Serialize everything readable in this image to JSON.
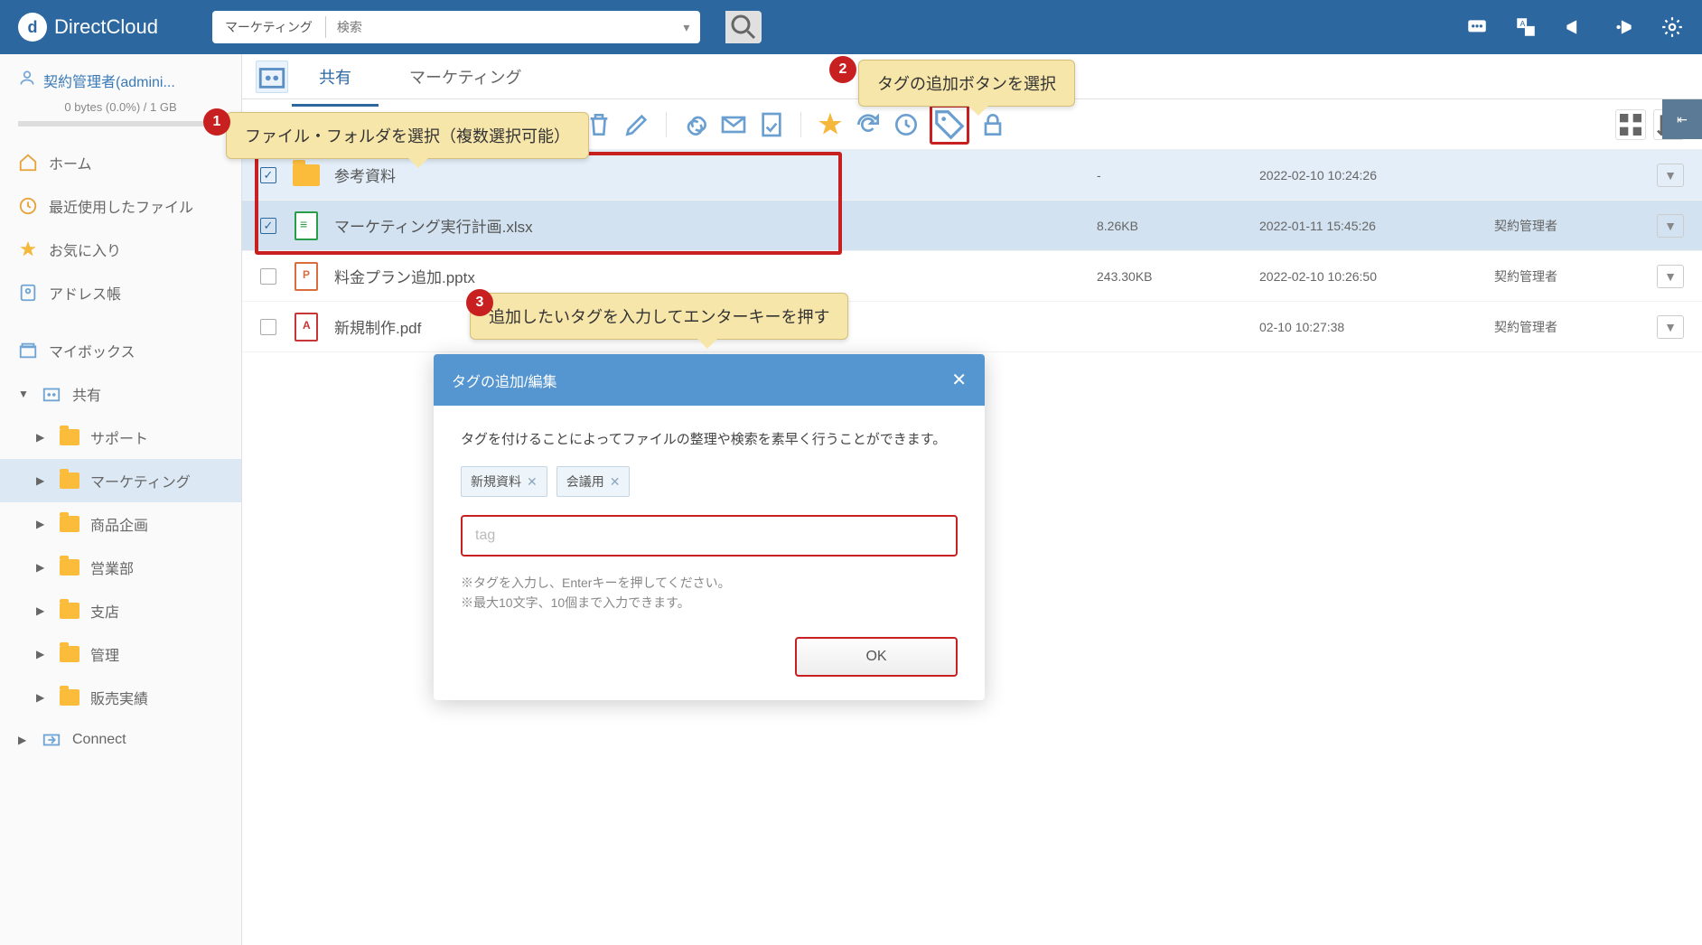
{
  "brand": "DirectCloud",
  "search": {
    "scope": "マーケティング",
    "placeholder": "検索",
    "value": ""
  },
  "user": {
    "display": "契約管理者(admini...",
    "storage": "0 bytes (0.0%) / 1 GB"
  },
  "sidebar": {
    "home": "ホーム",
    "recent": "最近使用したファイル",
    "favorites": "お気に入り",
    "addressbook": "アドレス帳",
    "mybox": "マイボックス",
    "shared": "共有",
    "folders": {
      "support": "サポート",
      "marketing": "マーケティング",
      "product": "商品企画",
      "sales": "営業部",
      "branch": "支店",
      "admin": "管理",
      "salesrec": "販売実績"
    },
    "connect": "Connect"
  },
  "tabs": {
    "shared": "共有",
    "current": "マーケティング"
  },
  "files": [
    {
      "name": "参考資料",
      "type": "folder",
      "size": "-",
      "date": "2022-02-10 10:24:26",
      "owner": "",
      "checked": true
    },
    {
      "name": "マーケティング実行計画.xlsx",
      "type": "xlsx",
      "size": "8.26KB",
      "date": "2022-01-11 15:45:26",
      "owner": "契約管理者",
      "checked": true
    },
    {
      "name": "料金プラン追加.pptx",
      "type": "pptx",
      "size": "243.30KB",
      "date": "2022-02-10 10:26:50",
      "owner": "契約管理者",
      "checked": false
    },
    {
      "name": "新規制作.pdf",
      "type": "pdf",
      "size": "",
      "date": "02-10 10:27:38",
      "owner": "契約管理者",
      "checked": false
    }
  ],
  "modal": {
    "title": "タグの追加/編集",
    "desc": "タグを付けることによってファイルの整理や検索を素早く行うことができます。",
    "tags": [
      "新規資料",
      "会議用"
    ],
    "placeholder": "tag",
    "hint1": "※タグを入力し、Enterキーを押してください。",
    "hint2": "※最大10文字、10個まで入力できます。",
    "ok": "OK"
  },
  "callouts": {
    "c1": "ファイル・フォルダを選択（複数選択可能）",
    "c2": "タグの追加ボタンを選択",
    "c3": "追加したいタグを入力してエンターキーを押す"
  }
}
